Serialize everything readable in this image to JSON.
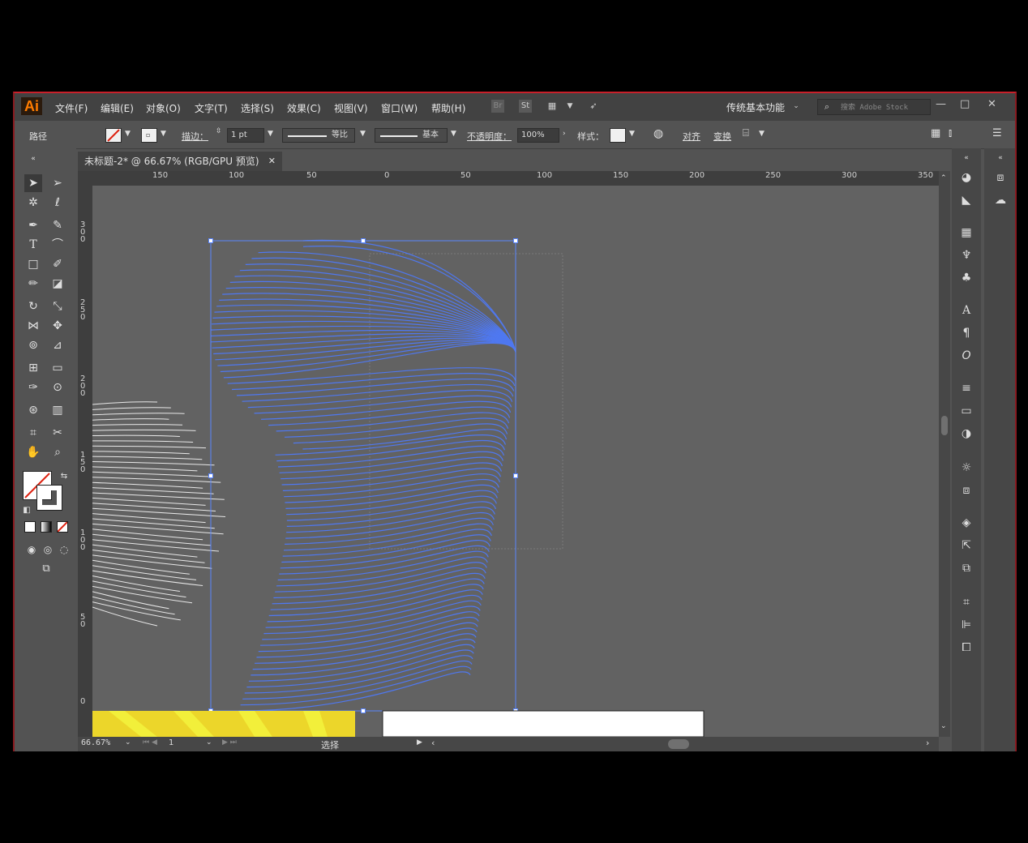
{
  "app": {
    "logo": "Ai"
  },
  "menu": [
    "文件(F)",
    "编辑(E)",
    "对象(O)",
    "文字(T)",
    "选择(S)",
    "效果(C)",
    "视图(V)",
    "窗口(W)",
    "帮助(H)"
  ],
  "menubar": {
    "bridge_label": "Br",
    "stock_label": "St",
    "workspace": "传统基本功能",
    "search_placeholder": "搜索 Adobe Stock",
    "minimize": "—",
    "restore": "□",
    "close": "✕"
  },
  "control_bar": {
    "selection_type": "路径",
    "stroke_label": "描边：",
    "stroke_weight": "1 pt",
    "profile_uniform": "等比",
    "brush_basic": "基本",
    "opacity_label": "不透明度：",
    "opacity_value": "100%",
    "style_label": "样式：",
    "align_label": "对齐",
    "transform_label": "变换"
  },
  "document_tab": {
    "title": "未标题-2* @ 66.67% (RGB/GPU 预览)",
    "close": "✕"
  },
  "ruler_h": [
    "150",
    "100",
    "50",
    "0",
    "50",
    "100",
    "150",
    "200",
    "250",
    "300",
    "350"
  ],
  "ruler_v": [
    "300",
    "250",
    "200",
    "150",
    "100",
    "50",
    "0"
  ],
  "status_bar": {
    "zoom": "66.67%",
    "artboard": "1",
    "tool": "选择"
  },
  "colors": {
    "path_blue": "#4f78f0",
    "selection": "#5a86ff",
    "canvas": "#626262",
    "accent_red": "#c8202a",
    "yellow": "#f0e030"
  }
}
